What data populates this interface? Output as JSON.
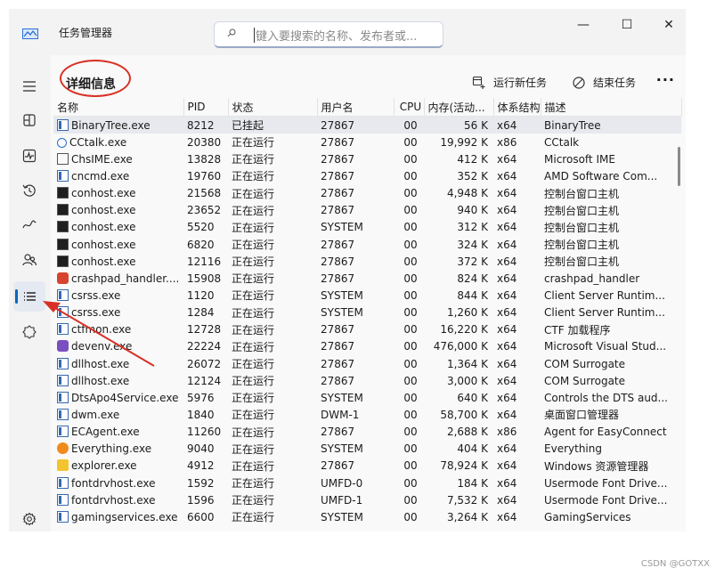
{
  "window": {
    "title": "任务管理器",
    "search_placeholder": "键入要搜索的名称、发布者或...",
    "buttons": {
      "minimize": "—",
      "maximize": "☐",
      "close": "✕"
    }
  },
  "sidebar": {
    "items": [
      {
        "name": "hamburger-menu",
        "active": false
      },
      {
        "name": "processes",
        "active": false
      },
      {
        "name": "performance",
        "active": false
      },
      {
        "name": "app-history",
        "active": false
      },
      {
        "name": "startup-apps",
        "active": false
      },
      {
        "name": "users",
        "active": false
      },
      {
        "name": "details",
        "active": true
      },
      {
        "name": "services",
        "active": false
      }
    ],
    "settings": "settings"
  },
  "header": {
    "title": "详细信息",
    "run_task": "运行新任务",
    "end_task": "结束任务",
    "more": "···"
  },
  "table": {
    "columns": [
      "名称",
      "PID",
      "状态",
      "用户名",
      "CPU",
      "内存(活动...",
      "体系结构",
      "描述"
    ],
    "rows": [
      {
        "icon": "app",
        "name": "BinaryTree.exe",
        "pid": "8212",
        "status": "已挂起",
        "user": "27867",
        "cpu": "00",
        "mem": "56 K",
        "arch": "x64",
        "desc": "BinaryTree",
        "selected": true
      },
      {
        "icon": "cc",
        "name": "CCtalk.exe",
        "pid": "20380",
        "status": "正在运行",
        "user": "27867",
        "cpu": "00",
        "mem": "19,992 K",
        "arch": "x86",
        "desc": "CCtalk"
      },
      {
        "icon": "ime",
        "name": "ChsIME.exe",
        "pid": "13828",
        "status": "正在运行",
        "user": "27867",
        "cpu": "00",
        "mem": "412 K",
        "arch": "x64",
        "desc": "Microsoft IME"
      },
      {
        "icon": "app",
        "name": "cncmd.exe",
        "pid": "19760",
        "status": "正在运行",
        "user": "27867",
        "cpu": "00",
        "mem": "352 K",
        "arch": "x64",
        "desc": "AMD Software Com..."
      },
      {
        "icon": "console",
        "name": "conhost.exe",
        "pid": "21568",
        "status": "正在运行",
        "user": "27867",
        "cpu": "00",
        "mem": "4,948 K",
        "arch": "x64",
        "desc": "控制台窗口主机"
      },
      {
        "icon": "console",
        "name": "conhost.exe",
        "pid": "23652",
        "status": "正在运行",
        "user": "27867",
        "cpu": "00",
        "mem": "940 K",
        "arch": "x64",
        "desc": "控制台窗口主机"
      },
      {
        "icon": "console",
        "name": "conhost.exe",
        "pid": "5520",
        "status": "正在运行",
        "user": "SYSTEM",
        "cpu": "00",
        "mem": "312 K",
        "arch": "x64",
        "desc": "控制台窗口主机"
      },
      {
        "icon": "console",
        "name": "conhost.exe",
        "pid": "6820",
        "status": "正在运行",
        "user": "27867",
        "cpu": "00",
        "mem": "324 K",
        "arch": "x64",
        "desc": "控制台窗口主机"
      },
      {
        "icon": "console",
        "name": "conhost.exe",
        "pid": "12116",
        "status": "正在运行",
        "user": "27867",
        "cpu": "00",
        "mem": "372 K",
        "arch": "x64",
        "desc": "控制台窗口主机"
      },
      {
        "icon": "crash",
        "name": "crashpad_handler....",
        "pid": "15908",
        "status": "正在运行",
        "user": "27867",
        "cpu": "00",
        "mem": "824 K",
        "arch": "x64",
        "desc": "crashpad_handler"
      },
      {
        "icon": "app",
        "name": "csrss.exe",
        "pid": "1120",
        "status": "正在运行",
        "user": "SYSTEM",
        "cpu": "00",
        "mem": "844 K",
        "arch": "x64",
        "desc": "Client Server Runtim..."
      },
      {
        "icon": "app",
        "name": "csrss.exe",
        "pid": "1284",
        "status": "正在运行",
        "user": "SYSTEM",
        "cpu": "00",
        "mem": "1,260 K",
        "arch": "x64",
        "desc": "Client Server Runtim..."
      },
      {
        "icon": "app",
        "name": "ctfmon.exe",
        "pid": "12728",
        "status": "正在运行",
        "user": "27867",
        "cpu": "00",
        "mem": "16,220 K",
        "arch": "x64",
        "desc": "CTF 加载程序"
      },
      {
        "icon": "vs",
        "name": "devenv.exe",
        "pid": "22224",
        "status": "正在运行",
        "user": "27867",
        "cpu": "00",
        "mem": "476,000 K",
        "arch": "x64",
        "desc": "Microsoft Visual Stud..."
      },
      {
        "icon": "app",
        "name": "dllhost.exe",
        "pid": "26072",
        "status": "正在运行",
        "user": "27867",
        "cpu": "00",
        "mem": "1,364 K",
        "arch": "x64",
        "desc": "COM Surrogate"
      },
      {
        "icon": "app",
        "name": "dllhost.exe",
        "pid": "12124",
        "status": "正在运行",
        "user": "27867",
        "cpu": "00",
        "mem": "3,000 K",
        "arch": "x64",
        "desc": "COM Surrogate"
      },
      {
        "icon": "app",
        "name": "DtsApo4Service.exe",
        "pid": "5976",
        "status": "正在运行",
        "user": "SYSTEM",
        "cpu": "00",
        "mem": "640 K",
        "arch": "x64",
        "desc": "Controls the DTS aud..."
      },
      {
        "icon": "app",
        "name": "dwm.exe",
        "pid": "1840",
        "status": "正在运行",
        "user": "DWM-1",
        "cpu": "00",
        "mem": "58,700 K",
        "arch": "x64",
        "desc": "桌面窗口管理器"
      },
      {
        "icon": "app",
        "name": "ECAgent.exe",
        "pid": "11260",
        "status": "正在运行",
        "user": "27867",
        "cpu": "00",
        "mem": "2,688 K",
        "arch": "x86",
        "desc": "Agent for EasyConnect"
      },
      {
        "icon": "ev",
        "name": "Everything.exe",
        "pid": "9040",
        "status": "正在运行",
        "user": "SYSTEM",
        "cpu": "00",
        "mem": "404 K",
        "arch": "x64",
        "desc": "Everything"
      },
      {
        "icon": "folder",
        "name": "explorer.exe",
        "pid": "4912",
        "status": "正在运行",
        "user": "27867",
        "cpu": "00",
        "mem": "78,924 K",
        "arch": "x64",
        "desc": "Windows 资源管理器"
      },
      {
        "icon": "app",
        "name": "fontdrvhost.exe",
        "pid": "1592",
        "status": "正在运行",
        "user": "UMFD-0",
        "cpu": "00",
        "mem": "184 K",
        "arch": "x64",
        "desc": "Usermode Font Drive..."
      },
      {
        "icon": "app",
        "name": "fontdrvhost.exe",
        "pid": "1596",
        "status": "正在运行",
        "user": "UMFD-1",
        "cpu": "00",
        "mem": "7,532 K",
        "arch": "x64",
        "desc": "Usermode Font Drive..."
      },
      {
        "icon": "app",
        "name": "gamingservices.exe",
        "pid": "6600",
        "status": "正在运行",
        "user": "SYSTEM",
        "cpu": "00",
        "mem": "3,264 K",
        "arch": "x64",
        "desc": "GamingServices"
      }
    ]
  },
  "colors": {
    "accent": "#0067c0",
    "annotation": "#d93025"
  },
  "watermark": "CSDN @GOTXX"
}
